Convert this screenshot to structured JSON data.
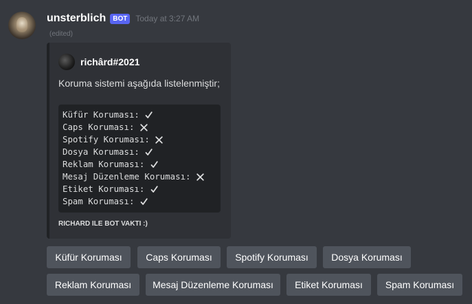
{
  "message": {
    "username": "unsterblich",
    "bot_tag": "BOT",
    "timestamp": "Today at 3:27 AM",
    "edited": "(edited)"
  },
  "embed": {
    "author": "richârd#2021",
    "description": "Koruma sistemi aşağıda listelenmiştir;",
    "code_lines": [
      {
        "text": "Küfür Koruması:",
        "status": "check"
      },
      {
        "text": "Caps Koruması:",
        "status": "cross"
      },
      {
        "text": "Spotify Koruması:",
        "status": "cross"
      },
      {
        "text": "Dosya Koruması:",
        "status": "check"
      },
      {
        "text": "Reklam Koruması:",
        "status": "check"
      },
      {
        "text": "Mesaj Düzenleme Koruması:",
        "status": "cross"
      },
      {
        "text": "Etiket Koruması:",
        "status": "check"
      },
      {
        "text": "Spam Koruması:",
        "status": "check"
      }
    ],
    "footer": "RICHARD ILE BOT VAKTI :)"
  },
  "buttons": {
    "row1": [
      "Küfür Koruması",
      "Caps Koruması",
      "Spotify Koruması",
      "Dosya Koruması"
    ],
    "row2": [
      "Reklam Koruması",
      "Mesaj Düzenleme Koruması",
      "Etiket Koruması",
      "Spam Koruması"
    ]
  },
  "colors": {
    "background": "#36393f",
    "embed_bg": "#2f3136",
    "code_bg": "#202225",
    "button_bg": "#4f545c",
    "bot_tag": "#5865f2"
  }
}
